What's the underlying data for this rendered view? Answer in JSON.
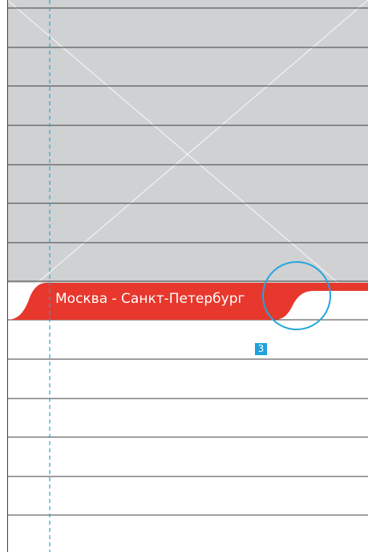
{
  "colors": {
    "image_placeholder_bg": "#d0d1d3",
    "grid_line": "#3f3f3f",
    "accent_red": "#e8372c",
    "guide_blue": "#22a6dc",
    "badge_bg": "#1fa2dd",
    "text_on_accent": "#ffffff"
  },
  "tab": {
    "label": "Москва - Санкт-Петербург"
  },
  "marker": {
    "number": "3"
  },
  "icons": {
    "placeholder": "image-placeholder-cross-icon",
    "highlight": "highlight-circle-icon"
  }
}
